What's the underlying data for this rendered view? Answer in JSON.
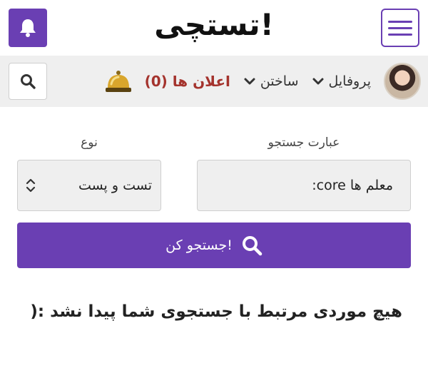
{
  "header": {
    "logo_text": "تستچی!",
    "accent_color": "#6a3fb3",
    "icons": [
      "bell-icon",
      "hamburger-menu-icon"
    ]
  },
  "nav": {
    "profile_label": "پروفایل",
    "build_label": "ساختن",
    "notifications_label": "اعلان ها (0)",
    "notifications_color": "#a4332d",
    "icons": [
      "search-icon",
      "avatar",
      "chevron-down-icon",
      "service-bell-icon"
    ]
  },
  "search": {
    "term_label": "عبارت جستجو",
    "term_value": "معلم ها core:",
    "type_label": "نوع",
    "type_value": "تست و پست",
    "submit_label": "جستجو کن!"
  },
  "results": {
    "empty_message": "هیچ موردی مرتبط با جستجوی شما پیدا نشد :("
  }
}
